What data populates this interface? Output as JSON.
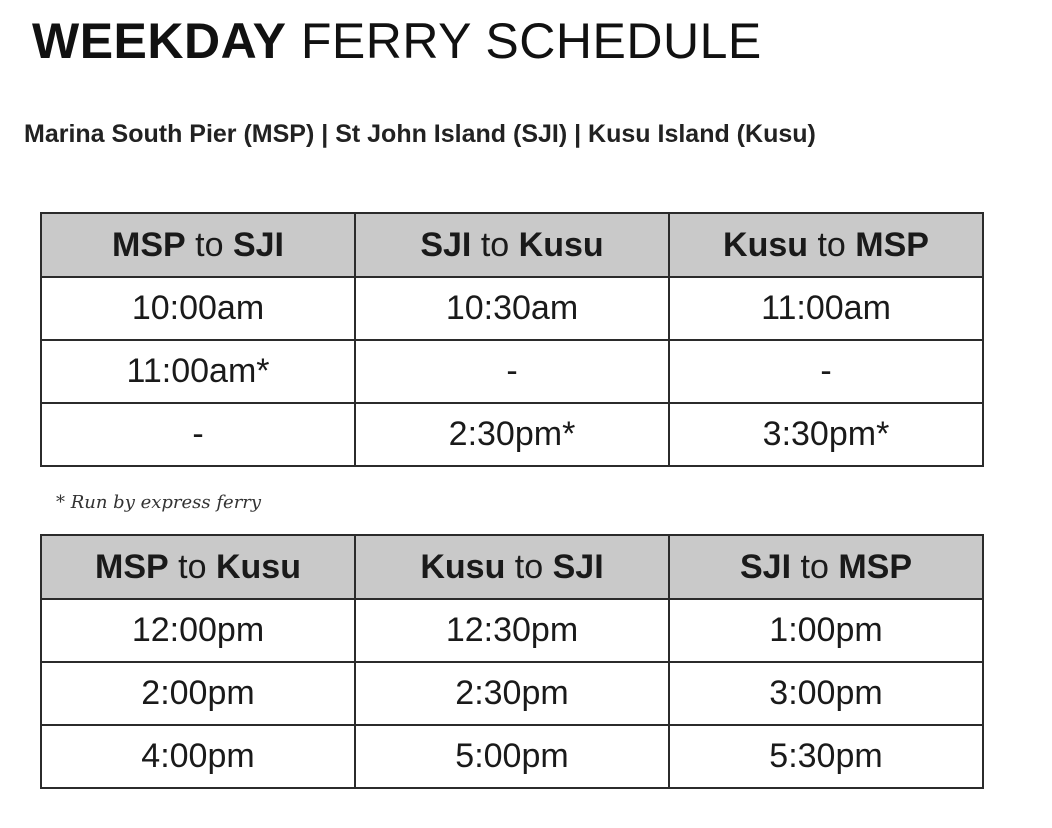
{
  "title": {
    "bold": "WEEKDAY",
    "rest": "FERRY SCHEDULE"
  },
  "subtitle": "Marina South Pier (MSP) | St John Island (SJI) | Kusu Island (Kusu)",
  "footnote": "* Run by express ferry",
  "tables": [
    {
      "headers": [
        {
          "from": "MSP",
          "to_word": "to",
          "dest": "SJI"
        },
        {
          "from": "SJI",
          "to_word": "to",
          "dest": "Kusu"
        },
        {
          "from": "Kusu",
          "to_word": "to",
          "dest": "MSP"
        }
      ],
      "rows": [
        [
          "10:00am",
          "10:30am",
          "11:00am"
        ],
        [
          "11:00am*",
          "-",
          "-"
        ],
        [
          "-",
          "2:30pm*",
          "3:30pm*"
        ]
      ]
    },
    {
      "headers": [
        {
          "from": "MSP",
          "to_word": "to",
          "dest": "Kusu"
        },
        {
          "from": "Kusu",
          "to_word": "to",
          "dest": "SJI"
        },
        {
          "from": "SJI",
          "to_word": "to",
          "dest": "MSP"
        }
      ],
      "rows": [
        [
          "12:00pm",
          "12:30pm",
          "1:00pm"
        ],
        [
          "2:00pm",
          "2:30pm",
          "3:00pm"
        ],
        [
          "4:00pm",
          "5:00pm",
          "5:30pm"
        ]
      ]
    }
  ]
}
